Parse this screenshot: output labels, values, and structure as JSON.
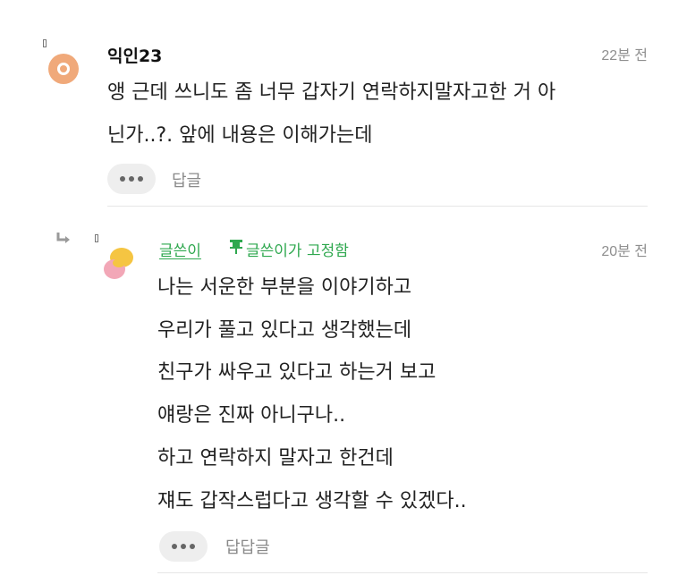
{
  "comment": {
    "author": "익인23",
    "time": "22분 전",
    "lines": [
      "앵 근데 쓰니도 좀 너무 갑자기 연락하지말자고한 거 아",
      "닌가..?. 앞에 내용은 이해가는데"
    ],
    "reply_label": "답글"
  },
  "reply": {
    "author": "글쓴이",
    "pinned_label": "글쓴이가 고정함",
    "time": "20분 전",
    "lines": [
      "나는 서운한 부분을 이야기하고",
      "우리가 풀고 있다고 생각했는데",
      "친구가 싸우고 있다고 하는거 보고",
      "얘랑은 진짜 아니구나..",
      "하고 연락하지 말자고 한건데",
      "쟤도 갑작스럽다고 생각할 수 있겠다.."
    ],
    "reply_label": "답답글"
  },
  "colors": {
    "accent_green": "#2fa84f",
    "avatar_orange": "#f0a97a",
    "avatar_yellow": "#f5c542",
    "avatar_pink": "#f2a7b7"
  }
}
